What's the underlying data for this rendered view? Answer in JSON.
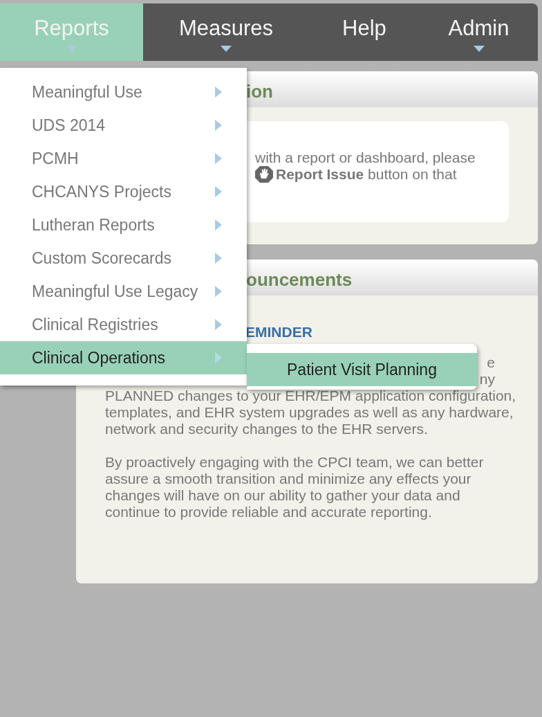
{
  "nav": [
    {
      "label": "Reports",
      "selected": true,
      "caret": true
    },
    {
      "label": "Measures",
      "selected": false,
      "caret": true
    },
    {
      "label": "Help",
      "selected": false,
      "caret": false
    },
    {
      "label": "Admin",
      "selected": false,
      "caret": true
    }
  ],
  "panels": [
    {
      "kind": "notice",
      "title": "ion",
      "lines": [
        {
          "text": "with a report or dashboard, please",
          "icon": false
        },
        {
          "text": "**Report Issue** button on that",
          "icon": true
        }
      ]
    },
    {
      "kind": "announce",
      "title": "ouncements",
      "heading": "EMINDER",
      "fragments": [
        "e",
        "ny"
      ],
      "paragraphs": [
        "PLANNED changes to your EHR/EPM application configuration, templates, and EHR system upgrades as well as any hardware, network and security changes to the EHR servers.",
        "By proactively engaging with the CPCI team, we can better assure a smooth transition and minimize any effects your changes will have on our ability to gather your data and continue to provide reliable and accurate reporting."
      ]
    }
  ],
  "menu": {
    "items": [
      {
        "label": "Meaningful Use",
        "selected": false,
        "has_submenu": true
      },
      {
        "label": "UDS 2014",
        "selected": false,
        "has_submenu": true
      },
      {
        "label": "PCMH",
        "selected": false,
        "has_submenu": true
      },
      {
        "label": "CHCANYS Projects",
        "selected": false,
        "has_submenu": true
      },
      {
        "label": "Lutheran Reports",
        "selected": false,
        "has_submenu": true
      },
      {
        "label": "Custom Scorecards",
        "selected": false,
        "has_submenu": true
      },
      {
        "label": "Meaningful Use Legacy",
        "selected": false,
        "has_submenu": true
      },
      {
        "label": "Clinical Registries",
        "selected": false,
        "has_submenu": true
      },
      {
        "label": "Clinical Operations",
        "selected": true,
        "has_submenu": true
      }
    ],
    "submenu": [
      {
        "label": "Patient Visit Planning",
        "selected": true
      }
    ]
  }
}
